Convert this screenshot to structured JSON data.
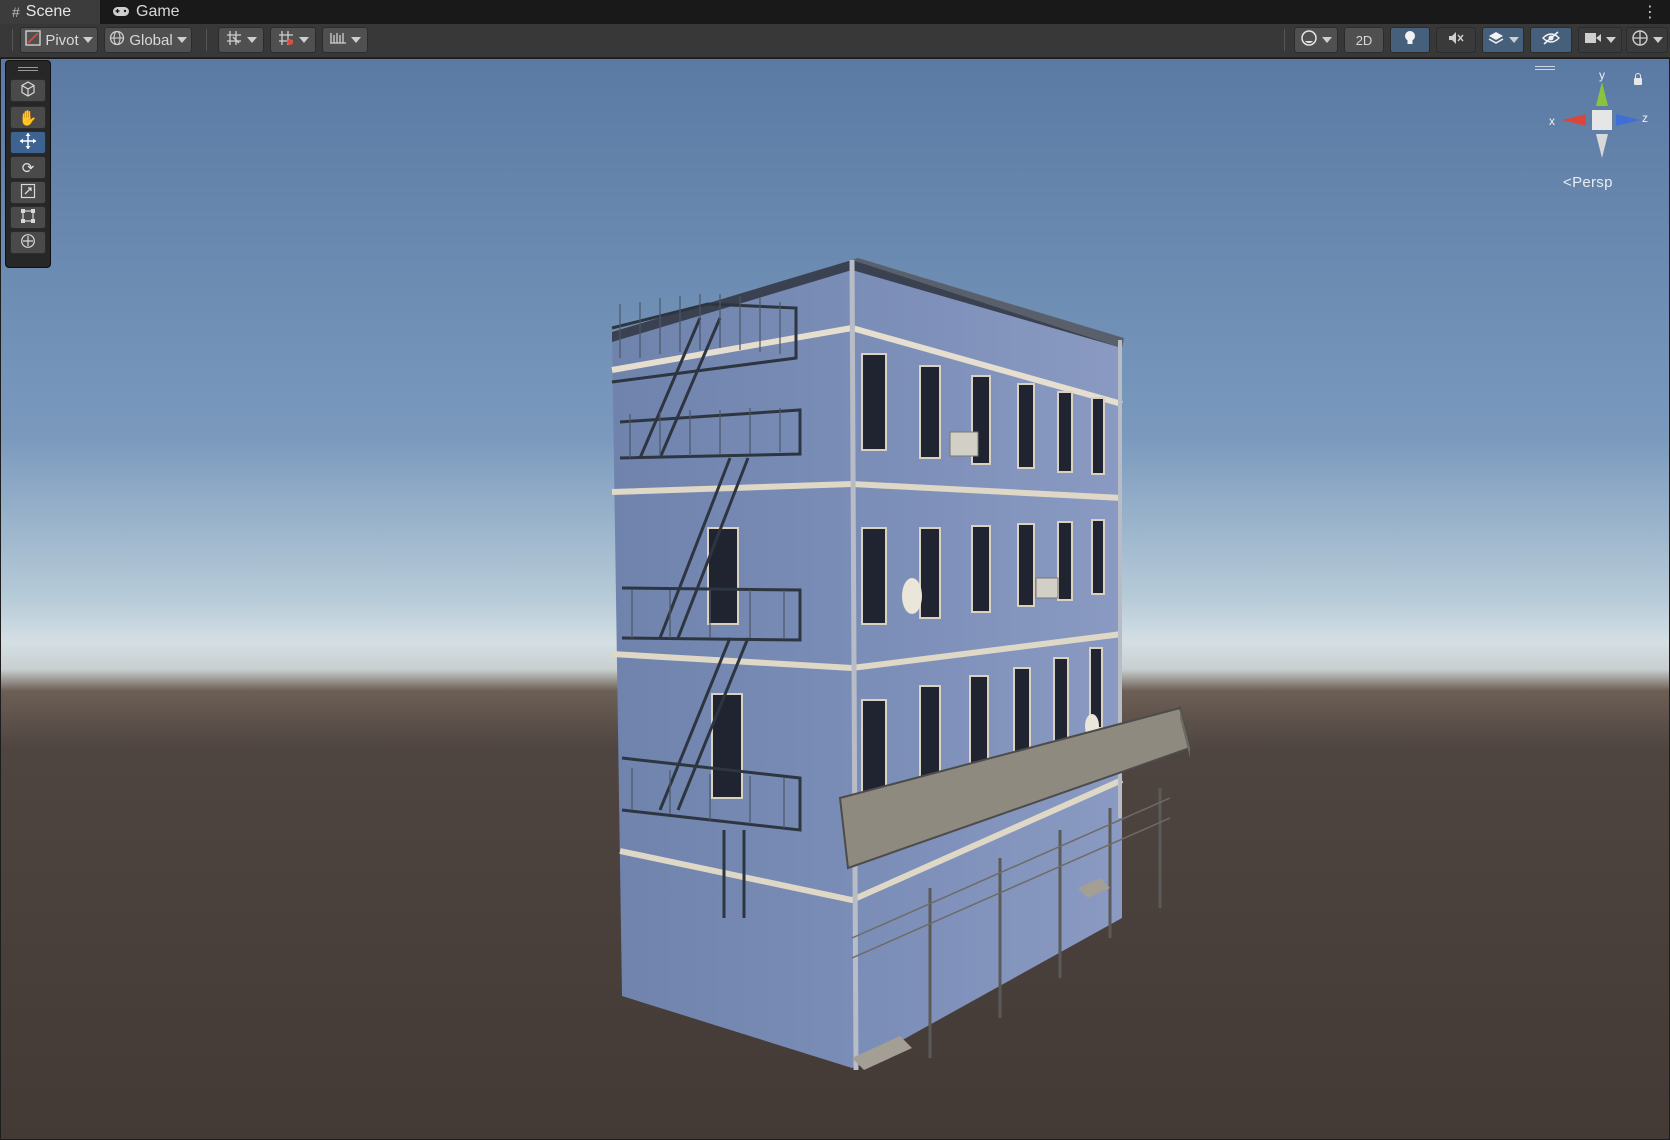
{
  "tabs": [
    {
      "label": "Scene",
      "icon": "scene-grid-icon",
      "active": true
    },
    {
      "label": "Game",
      "icon": "gamepad-icon",
      "active": false
    }
  ],
  "toolbar": {
    "pivot_label": "Pivot",
    "global_label": "Global",
    "two_d_label": "2D"
  },
  "gizmo": {
    "x_label": "x",
    "y_label": "y",
    "z_label": "z",
    "projection_label": "Persp",
    "colors": {
      "x": "#d9463a",
      "y": "#8ac43f",
      "z": "#3f6fd6"
    }
  },
  "tools": [
    "view-tool",
    "hand-tool",
    "move-tool",
    "rotate-tool",
    "scale-tool",
    "rect-tool",
    "transform-tool"
  ],
  "active_tool": "move-tool"
}
